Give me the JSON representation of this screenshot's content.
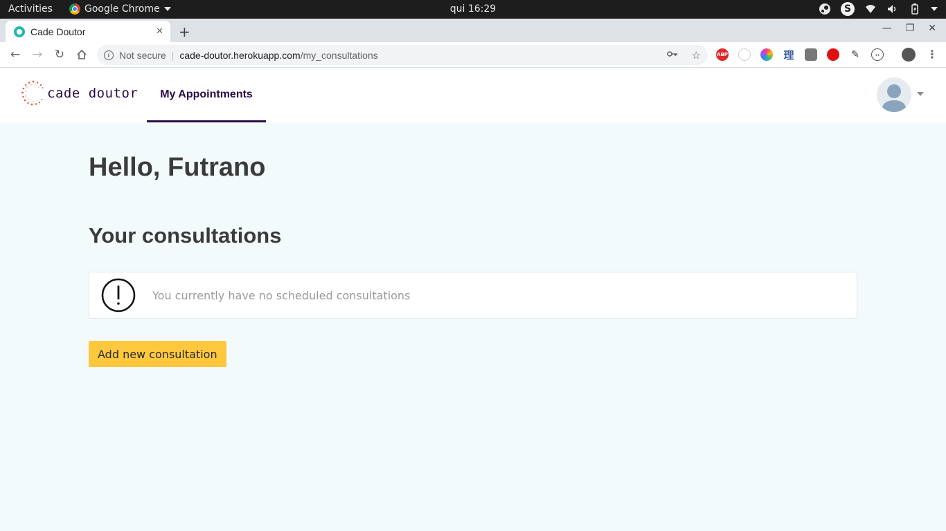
{
  "os_bar": {
    "activities": "Activities",
    "app_name": "Google Chrome",
    "clock": "qui 16:29",
    "skype_letter": "S"
  },
  "browser": {
    "tab_title": "Cade Doutor",
    "security_label": "Not secure",
    "url_host": "cade-doutor.herokuapp.com",
    "url_path": "/my_consultations",
    "extensions": [
      {
        "name": "adblock-plus-icon",
        "label": "ABP",
        "color": "#e0292b"
      },
      {
        "name": "timer-extension-icon",
        "label": "",
        "color": "#cfcfcf"
      },
      {
        "name": "color-picker-extension-icon",
        "label": "",
        "color": "#ff3d7f"
      },
      {
        "name": "kanji-extension-icon",
        "label": "理",
        "color": "#3a5f9f"
      },
      {
        "name": "qr-extension-icon",
        "label": "",
        "color": "#666666"
      },
      {
        "name": "red-hand-extension-icon",
        "label": "",
        "color": "#e01010"
      },
      {
        "name": "eyedropper-extension-icon",
        "label": "",
        "color": "#333333"
      },
      {
        "name": "code-extension-icon",
        "label": "",
        "color": "#555555"
      }
    ]
  },
  "header": {
    "brand": "cade doutor",
    "nav_link": "My Appointments"
  },
  "main": {
    "greeting": "Hello, Futrano",
    "section_title": "Your consultations",
    "empty_message": "You currently have no scheduled consultations",
    "add_button": "Add new consultation"
  },
  "colors": {
    "brand_purple": "#2a0a47",
    "accent_yellow": "#fdc73e",
    "page_bg": "#f3fafb"
  }
}
